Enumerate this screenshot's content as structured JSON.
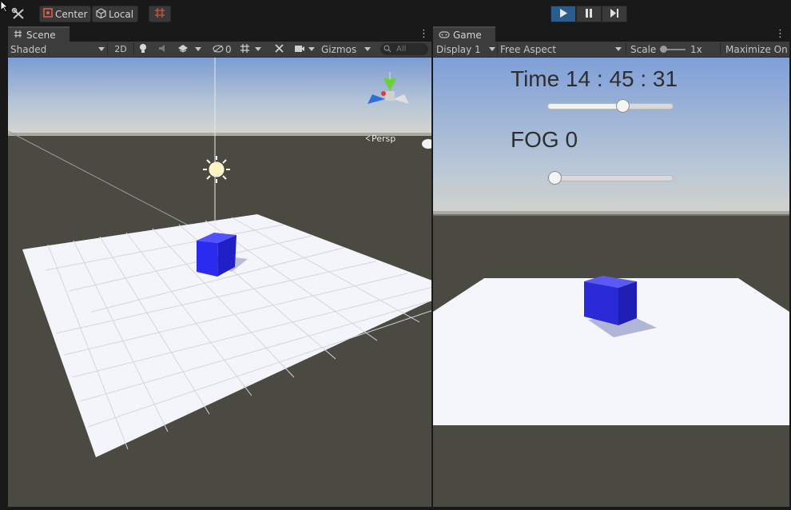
{
  "topbar": {
    "center_label": "Center",
    "local_label": "Local"
  },
  "scene": {
    "tab_label": "Scene",
    "shading_mode": "Shaded",
    "mode_2d": "2D",
    "hidden_count": "0",
    "gizmos_label": "Gizmos",
    "search_placeholder": "All",
    "persp_label": "Persp"
  },
  "game": {
    "tab_label": "Game",
    "display": "Display 1",
    "aspect": "Free Aspect",
    "scale_label": "Scale",
    "scale_value": "1x",
    "scale_slider": 0.0,
    "maximize_label": "Maximize On P",
    "time_text": "Time 14 : 45 : 31",
    "time_slider": 0.61,
    "fog_text": "FOG 0",
    "fog_slider": 0.0
  },
  "colors": {
    "cube": "#2b2bf0",
    "sky_top": "#7f9fd8",
    "ground": "#4a4a44",
    "play_active": "#2b5d8c"
  }
}
